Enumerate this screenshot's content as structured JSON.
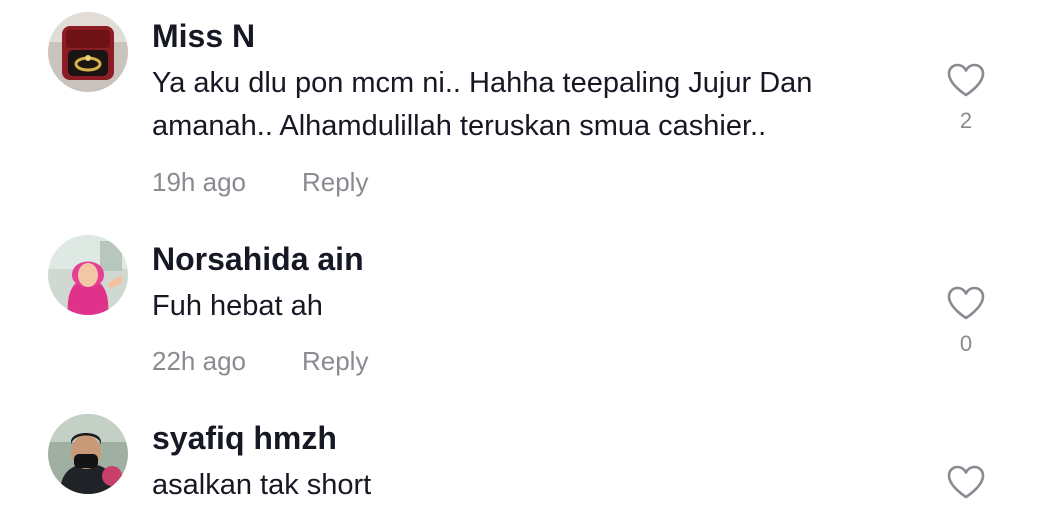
{
  "comments": [
    {
      "username": "Miss N",
      "text": "Ya aku dlu pon mcm ni.. Hahha teepaling Jujur Dan amanah.. Alhamdulillah teruskan smua cashier..",
      "time": "19h ago",
      "reply_label": "Reply",
      "likes": "2"
    },
    {
      "username": "Norsahida ain",
      "text": "Fuh hebat ah",
      "time": "22h ago",
      "reply_label": "Reply",
      "likes": "0"
    },
    {
      "username": "syafiq hmzh",
      "text": "asalkan tak short"
    }
  ],
  "icons": {
    "like": "heart-outline-icon"
  },
  "colors": {
    "text_primary": "#161823",
    "text_secondary": "#8a8b91",
    "background": "#ffffff"
  }
}
